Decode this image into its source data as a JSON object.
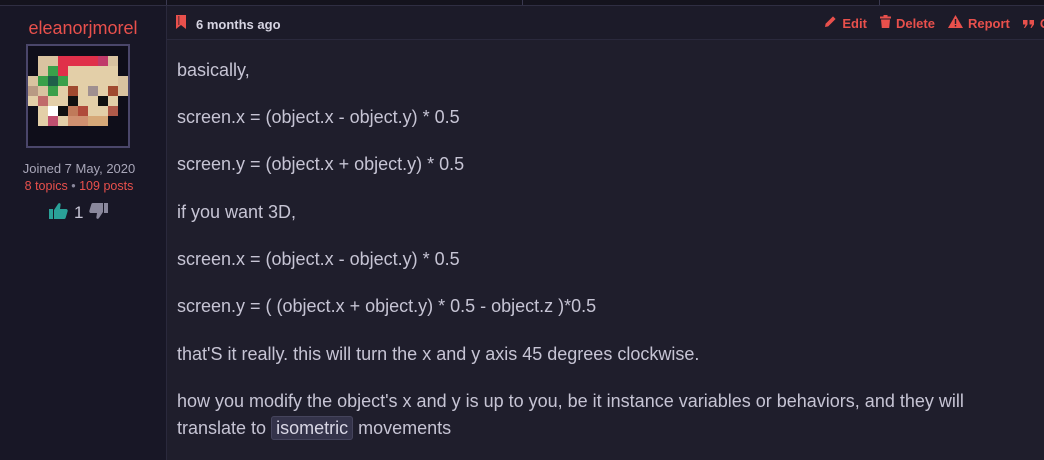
{
  "user": {
    "name": "eleanorjmorel",
    "joined": "Joined 7 May, 2020",
    "topics": "8 topics",
    "separator": "•",
    "posts": "109 posts",
    "vote_count": "1"
  },
  "post": {
    "time": "6 months ago",
    "actions": {
      "edit": "Edit",
      "delete": "Delete",
      "report": "Report",
      "quote": "Q"
    },
    "lines": [
      "basically,",
      "screen.x = (object.x - object.y) * 0.5",
      "screen.y = (object.x + object.y) * 0.5",
      "if you want 3D,",
      "screen.x = (object.x - object.y) * 0.5",
      "screen.y = ( (object.x + object.y) * 0.5 - object.z )*0.5",
      "that'S it really. this will turn the x and y axis 45 degrees clockwise.",
      "how you modify the object's x and y is up to you, be it instance variables or behaviors, and they will"
    ],
    "last_line_prefix": "translate to",
    "last_line_code": "isometric",
    "last_line_suffix": "movements"
  },
  "colors": {
    "accent": "#e8504c",
    "upvote": "#2aa198",
    "background": "#1f1e2c",
    "sidebar": "#181726"
  },
  "icons": [
    "bookmark-icon",
    "pencil-icon",
    "trash-icon",
    "warning-icon",
    "quote-icon",
    "thumbs-up-icon",
    "thumbs-down-icon"
  ]
}
